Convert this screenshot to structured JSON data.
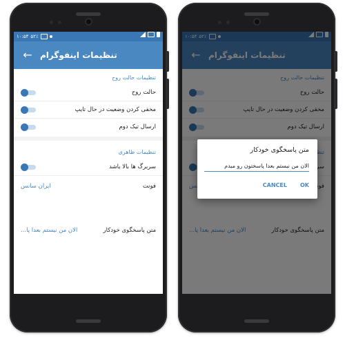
{
  "status_bar": {
    "time": "۱۰:۵۴",
    "battery_pct": "۵۲٪"
  },
  "app_bar": {
    "title": "تنظیمات اینفوگرام"
  },
  "settings": {
    "section_ghost": "تنظیمات حالت روح",
    "ghost_mode": "حالت روح",
    "hide_typing": "مخفی کردن وضعیت در حال تایپ",
    "send_double_tick": "ارسال تیک دوم",
    "section_appearance": "تنظیمات ظاهری",
    "headers_on_top": "سربرگ ها بالا باشد",
    "font_label": "فونت",
    "font_value": "ایران سانس",
    "auto_reply_label": "متن پاسخگوی خودکار",
    "auto_reply_value": "الان من نیستم بعدا پا..."
  },
  "dialog": {
    "title": "متن پاسخگوی خودکار",
    "input_value": "الان من نیستم بعدا پاسختون رو میدم",
    "cancel_label": "CANCEL",
    "ok_label": "OK"
  },
  "colors": {
    "status_bar": "#3a78b5",
    "app_bar": "#4a88c2",
    "accent": "#4a88c2",
    "toggle_knob": "#3a78b5"
  },
  "icons": [
    "back-arrow-icon",
    "wifi-icon",
    "signal-icon",
    "battery-icon",
    "notification-icon"
  ]
}
